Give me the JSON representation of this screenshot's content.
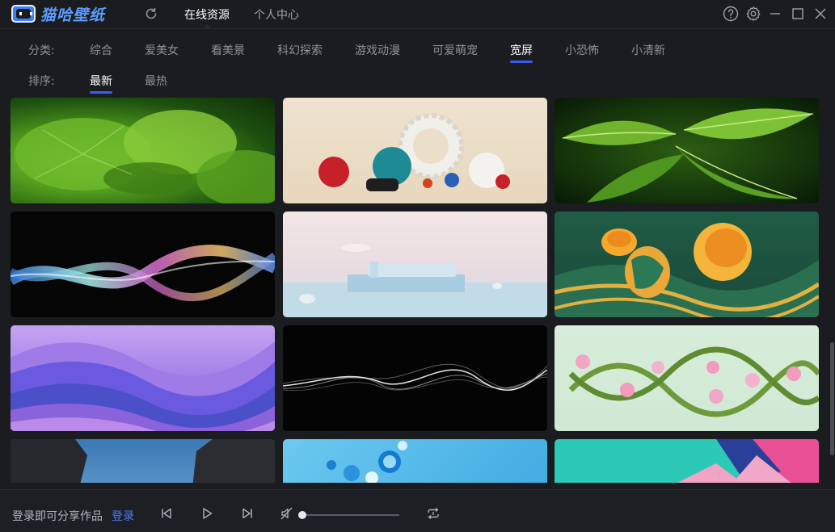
{
  "app": {
    "name": "猫哈壁纸"
  },
  "top_tabs": [
    {
      "label": "在线资源",
      "active": true
    },
    {
      "label": "个人中心",
      "active": false
    }
  ],
  "categories": {
    "label": "分类:",
    "items": [
      "综合",
      "爱美女",
      "看美景",
      "科幻探索",
      "游戏动漫",
      "可爱萌宠",
      "宽屏",
      "小恐怖",
      "小清新"
    ],
    "selected": "宽屏"
  },
  "sort": {
    "label": "排序:",
    "items": [
      "最新",
      "最热"
    ],
    "selected": "最新"
  },
  "thumbnails": [
    {
      "subject": "green lotus leaves"
    },
    {
      "subject": "3d spheres and gear"
    },
    {
      "subject": "tropical leaves"
    },
    {
      "subject": "iridescent glass wave"
    },
    {
      "subject": "floating bed on water"
    },
    {
      "subject": "orange halves on green waves"
    },
    {
      "subject": "purple blue waves"
    },
    {
      "subject": "white smoke wave on black"
    },
    {
      "subject": "flowering dna helix"
    },
    {
      "subject": "rocks and sky"
    },
    {
      "subject": "blue glass bubbles"
    },
    {
      "subject": "geometric pink teal"
    }
  ],
  "bottom": {
    "share_text": "登录即可分享作品",
    "login_label": "登录",
    "volume_level": 0.0
  },
  "colors": {
    "accent": "#3b5cf5",
    "link": "#4b7bff",
    "background": "#1b1c20"
  },
  "icons": [
    "refresh-icon",
    "help-icon",
    "settings-icon",
    "minimize-icon",
    "maximize-icon",
    "close-icon",
    "previous-icon",
    "play-icon",
    "next-icon",
    "mute-icon",
    "loop-icon"
  ]
}
